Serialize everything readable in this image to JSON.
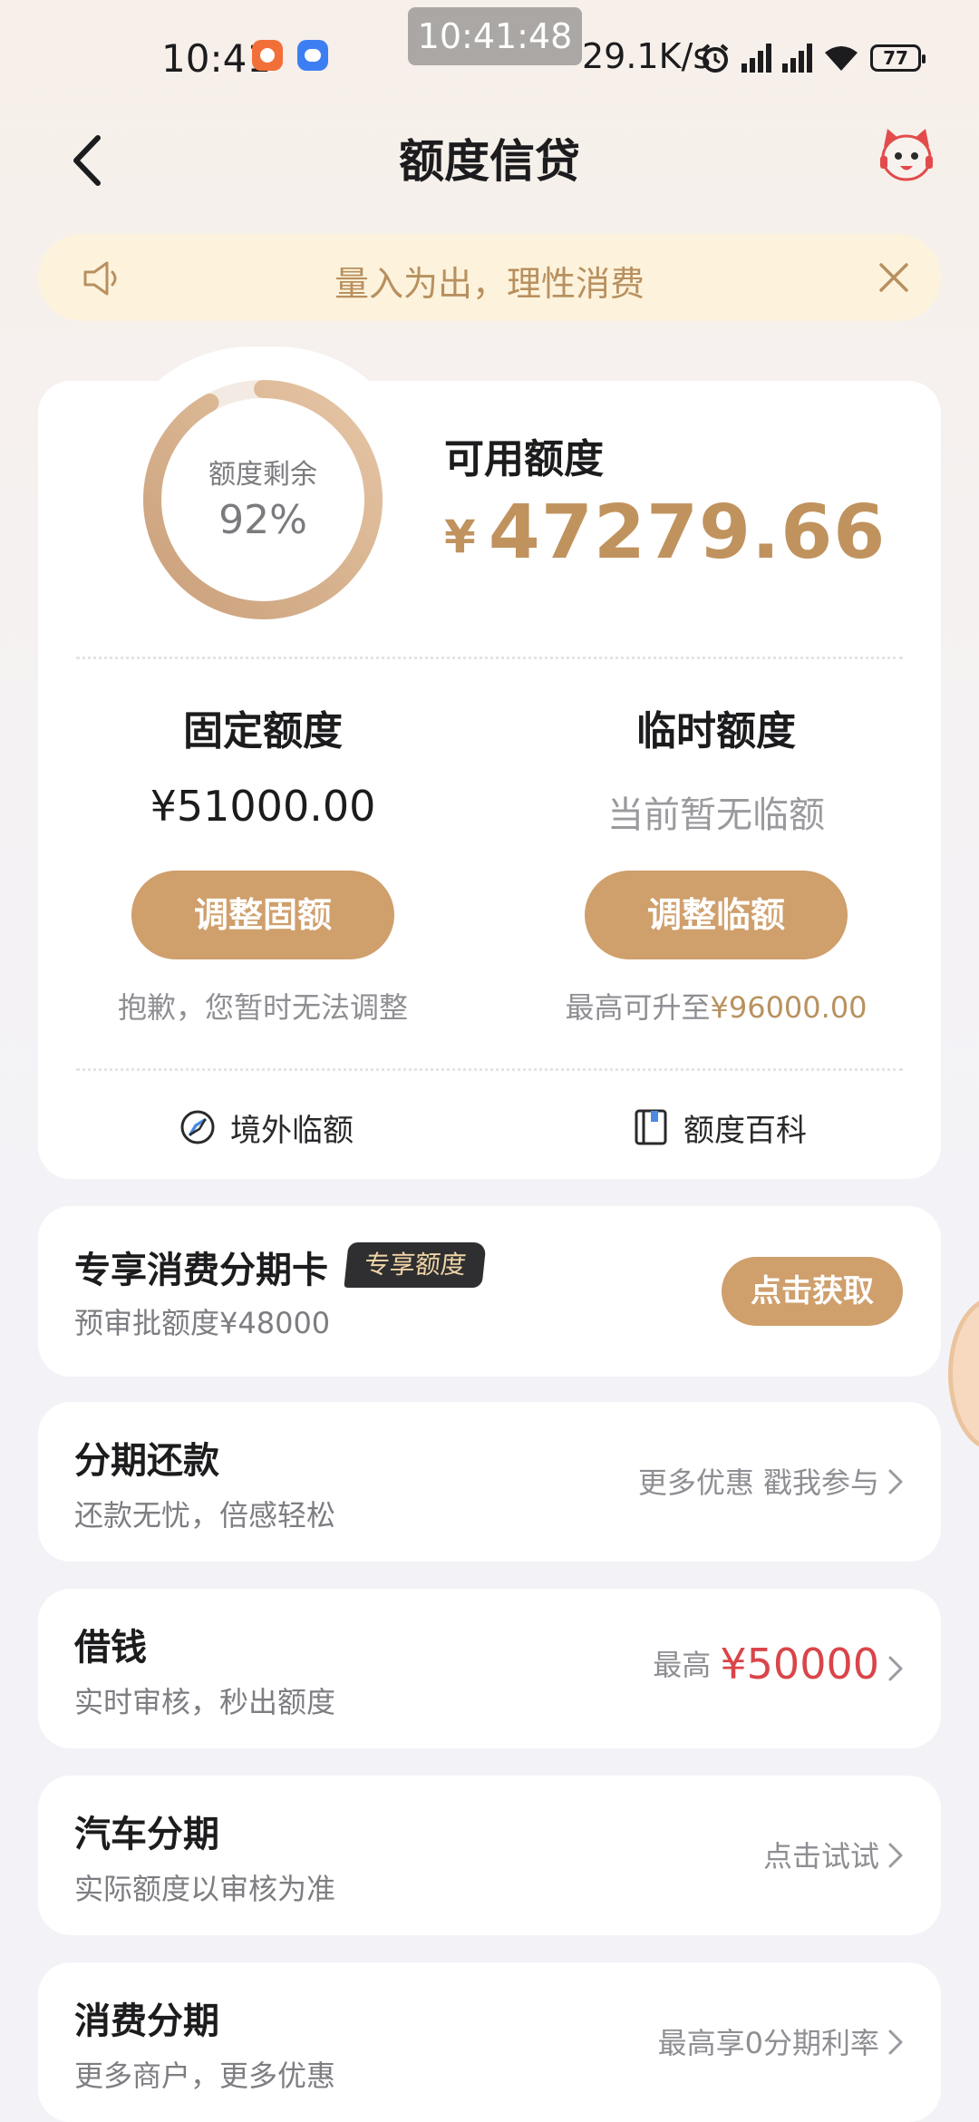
{
  "status_bar": {
    "time": "10:41",
    "center_time": "10:41:48",
    "net_speed": "29.1K/s",
    "battery": "77"
  },
  "header": {
    "title": "额度信贷"
  },
  "notice": {
    "text": "量入为出，理性消费"
  },
  "quota": {
    "ring_label": "额度剩余",
    "ring_percent": "92%",
    "ring_fraction": 0.92,
    "available_label": "可用额度",
    "available_currency": "¥",
    "available_value": "47279.66",
    "fixed": {
      "title": "固定额度",
      "value": "¥51000.00",
      "button": "调整固额",
      "note": "抱歉，您暂时无法调整"
    },
    "temporary": {
      "title": "临时额度",
      "value": "当前暂无临额",
      "button": "调整临额",
      "note_prefix": "最高可升至",
      "note_amount": "¥96000.00"
    },
    "links": {
      "overseas": "境外临额",
      "wiki": "额度百科"
    }
  },
  "exclusive": {
    "title": "专享消费分期卡",
    "badge": "专享额度",
    "subtitle": "预审批额度¥48000",
    "button": "点击获取"
  },
  "services": [
    {
      "title": "分期还款",
      "subtitle": "还款无忧，倍感轻松",
      "right_text": "更多优惠 戳我参与"
    },
    {
      "title": "借钱",
      "subtitle": "实时审核，秒出额度",
      "right_prefix": "最高",
      "right_amount": "¥50000"
    },
    {
      "title": "汽车分期",
      "subtitle": "实际额度以审核为准",
      "right_text": "点击试试"
    },
    {
      "title": "消费分期",
      "subtitle": "更多商户，更多优惠",
      "right_text": "最高享0分期利率"
    }
  ],
  "colors": {
    "gold": "#c0935e",
    "button_gold": "#cf9f6c",
    "notice_bg": "#fdf3dc",
    "red": "#d9454a"
  }
}
